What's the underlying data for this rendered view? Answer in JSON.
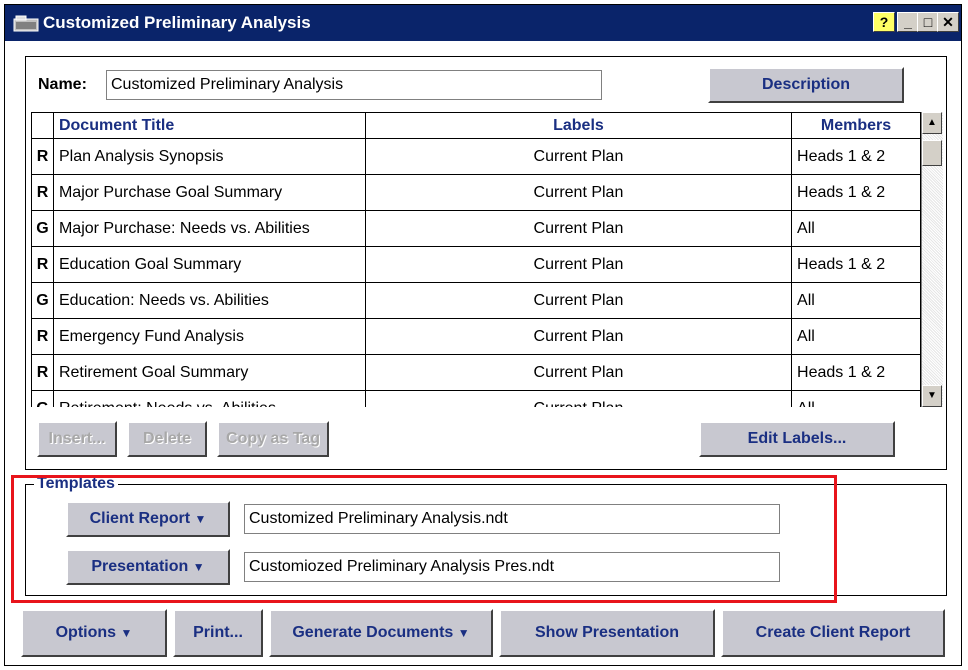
{
  "window": {
    "title": "Customized Preliminary Analysis",
    "help_label": "?",
    "minimize_label": "_",
    "maximize_label": "□",
    "close_label": "✕"
  },
  "name_field": {
    "label": "Name:",
    "value": "Customized Preliminary Analysis"
  },
  "buttons": {
    "description": "Description",
    "insert": "Insert...",
    "delete": "Delete",
    "copy_as_tag": "Copy as Tag",
    "edit_labels": "Edit Labels..."
  },
  "table": {
    "columns": [
      "Document Title",
      "Labels",
      "Members"
    ],
    "rows": [
      {
        "type": "R",
        "title": "Plan Analysis Synopsis",
        "label": "Current Plan",
        "members": "Heads 1 & 2"
      },
      {
        "type": "R",
        "title": "Major Purchase Goal Summary",
        "label": "Current Plan",
        "members": "Heads 1 & 2"
      },
      {
        "type": "G",
        "title": "Major Purchase: Needs vs. Abilities",
        "label": "Current Plan",
        "members": "All"
      },
      {
        "type": "R",
        "title": "Education Goal Summary",
        "label": "Current Plan",
        "members": "Heads 1 & 2"
      },
      {
        "type": "G",
        "title": "Education: Needs vs. Abilities",
        "label": "Current Plan",
        "members": "All"
      },
      {
        "type": "R",
        "title": "Emergency Fund Analysis",
        "label": "Current Plan",
        "members": "All"
      },
      {
        "type": "R",
        "title": "Retirement Goal Summary",
        "label": "Current Plan",
        "members": "Heads 1 & 2"
      },
      {
        "type": "G",
        "title": "Retirement: Needs vs. Abilities",
        "label": "Current Plan",
        "members": "All"
      }
    ]
  },
  "templates": {
    "legend": "Templates",
    "client_report_label": "Client Report",
    "client_report_value": "Customized Preliminary Analysis.ndt",
    "presentation_label": "Presentation",
    "presentation_value": "Customiozed Preliminary Analysis Pres.ndt",
    "highlight_color": "#e8141b"
  },
  "bottom_buttons": {
    "options": "Options",
    "print": "Print...",
    "generate": "Generate Documents",
    "show_presentation": "Show Presentation",
    "create_client_report": "Create Client Report"
  },
  "dropdown_glyph": "▼",
  "colors": {
    "titlebar": "#0a246a",
    "button_face": "#c8c8d0",
    "button_text": "#1a2f82"
  }
}
